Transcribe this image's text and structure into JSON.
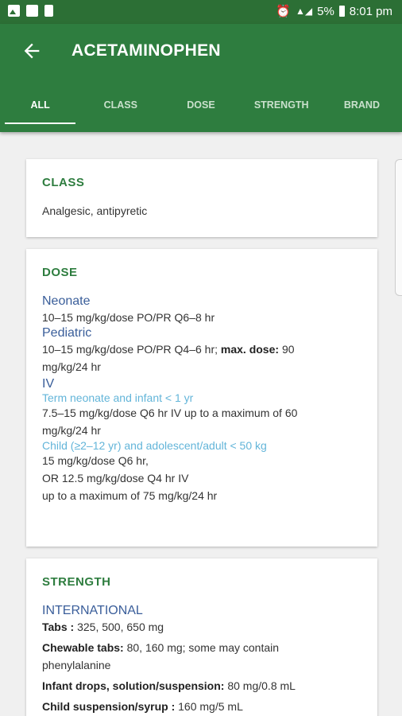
{
  "status": {
    "battery": "5%",
    "time": "8:01 pm"
  },
  "appbar": {
    "title": "ACETAMINOPHEN"
  },
  "tabs": [
    "ALL",
    "CLASS",
    "DOSE",
    "STRENGTH",
    "BRAND"
  ],
  "class_card": {
    "heading": "CLASS",
    "text": "Analgesic, antipyretic"
  },
  "dose_card": {
    "heading": "DOSE",
    "neonate_title": "Neonate",
    "neonate_text": "10–15 mg/kg/dose PO/PR Q6–8 hr",
    "pediatric_title": "Pediatric",
    "pediatric_text_a": "10–15 mg/kg/dose PO/PR Q4–6 hr;",
    "pediatric_bold": "max. dose:",
    "pediatric_text_b": "90",
    "pediatric_text_c": "mg/kg/24 hr",
    "iv_title": "IV",
    "iv_sub1": "Term neonate and infant < 1 yr",
    "iv_text1a": "7.5–15 mg/kg/dose Q6 hr IV up to a maximum of 60",
    "iv_text1b": "mg/kg/24 hr",
    "iv_sub2": "Child (≥2–12 yr) and adolescent/adult < 50 kg",
    "iv_text2a": "15 mg/kg/dose Q6 hr,",
    "iv_text2b": "OR 12.5 mg/kg/dose Q4 hr IV",
    "iv_text2c": "up to a maximum of 75 mg/kg/24 hr"
  },
  "strength_card": {
    "heading": "STRENGTH",
    "intl_title": "INTERNATIONAL",
    "tabs_label": "Tabs :",
    "tabs_value": "325, 500, 650 mg",
    "chew_label": "Chewable tabs:",
    "chew_value_a": "80, 160 mg; some may contain",
    "chew_value_b": "phenylalanine",
    "infant_label": "Infant drops, solution/suspension:",
    "infant_value": "80 mg/0.8 mL",
    "child_label": "Child suspension/syrup :",
    "child_value": "160 mg/5 mL"
  }
}
